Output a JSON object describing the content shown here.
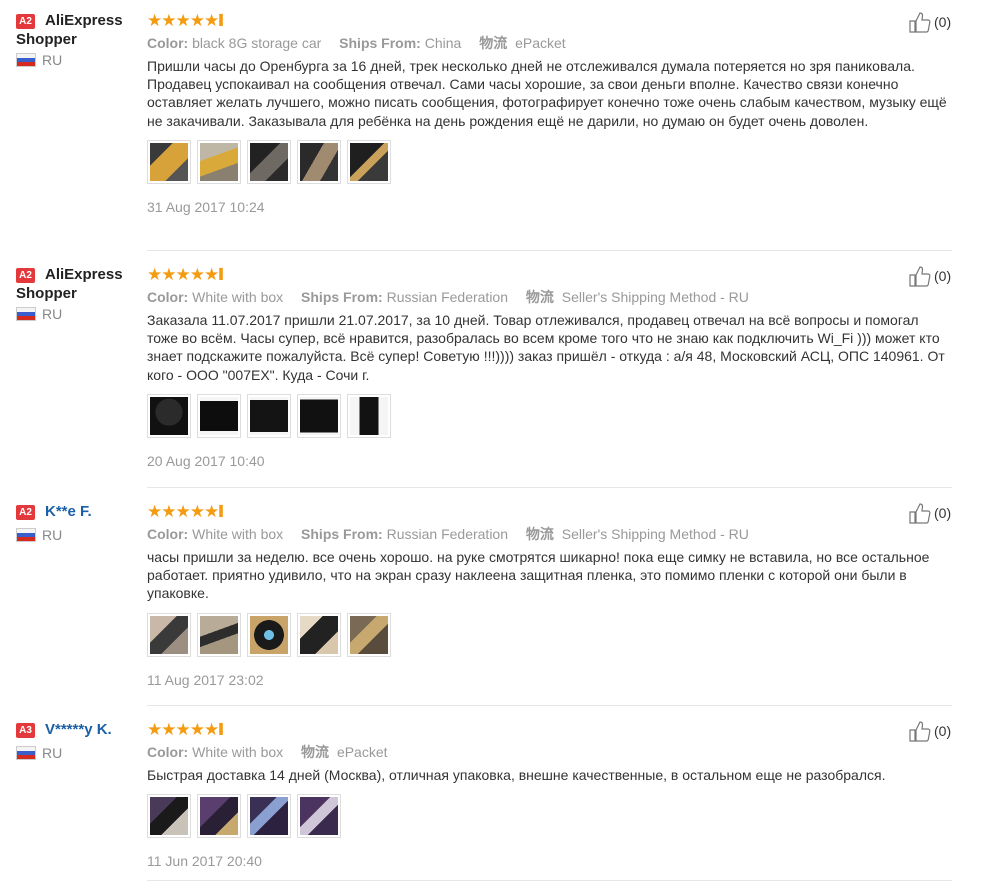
{
  "labels": {
    "color": "Color:",
    "ships_from": "Ships From:",
    "logistics": "物流"
  },
  "reviews": [
    {
      "level": "A2",
      "name": "AliExpress",
      "name2": "Shopper",
      "country": "RU",
      "rating": "5",
      "color": "black 8G storage car",
      "ships_from": "China",
      "logistics": "ePacket",
      "text": "Пришли часы до Оренбурга за 16 дней, трек несколько дней не отслеживался думала потеряется но зря паниковала. Продавец успокаивал на сообщения отвечал. Сами часы хорошие, за свои деньги вполне. Качество связи конечно оставляет желать лучшего, можно писать сообщения, фотографирует конечно тоже очень слабым качеством, музыку ещё не закачивали. Заказывала для ребёнка на день рождения ещё не дарили, но думаю он будет очень доволен.",
      "date": "31 Aug 2017 10:24",
      "likes": "(0)",
      "photos": 5
    },
    {
      "level": "A2",
      "name": "AliExpress",
      "name2": "Shopper",
      "country": "RU",
      "rating": "5",
      "color": "White with box",
      "ships_from": "Russian Federation",
      "logistics": "Seller's Shipping Method - RU",
      "text": "Заказала 11.07.2017 пришли 21.07.2017, за 10 дней. Товар отлеживался, продавец отвечал на всё вопросы и помогал тоже во всём. Часы супер, всё нравится, разобралась во всем кроме того что не знаю как подключить Wi_Fi ))) может кто знает подскажите пожалуйста. Всё супер! Советую !!!)))) заказ пришёл - откуда : а/я 48, Московский АСЦ, ОПС 140961. От кого - ООО \"007ЕХ\". Куда - Сочи г.",
      "date": "20 Aug 2017 10:40",
      "likes": "(0)",
      "photos": 5
    },
    {
      "level": "A2",
      "name": "K**e F.",
      "name2": "",
      "country": "RU",
      "rating": "5",
      "color": "White with box",
      "ships_from": "Russian Federation",
      "logistics": "Seller's Shipping Method - RU",
      "text": "часы пришли за неделю. все очень хорошо. на руке смотрятся шикарно! пока еще симку не вставила, но все остальное работает. приятно удивило, что на экран сразу наклеена защитная пленка, это помимо пленки с которой они были в упаковке.",
      "date": "11 Aug 2017 23:02",
      "likes": "(0)",
      "photos": 5
    },
    {
      "level": "A3",
      "name": "V*****y K.",
      "name2": "",
      "country": "RU",
      "rating": "5",
      "color": "White with box",
      "ships_from": "",
      "logistics": "ePacket",
      "text": "Быстрая доставка 14 дней (Москва), отличная упаковка, внешне качественные, в остальном еще не разобрался.",
      "date": "11 Jun 2017 20:40",
      "likes": "(0)",
      "photos": 4
    }
  ],
  "colors": {
    "badge": "#e4393c",
    "star": "#f39c12",
    "masked_name": "#1a5fa8"
  }
}
